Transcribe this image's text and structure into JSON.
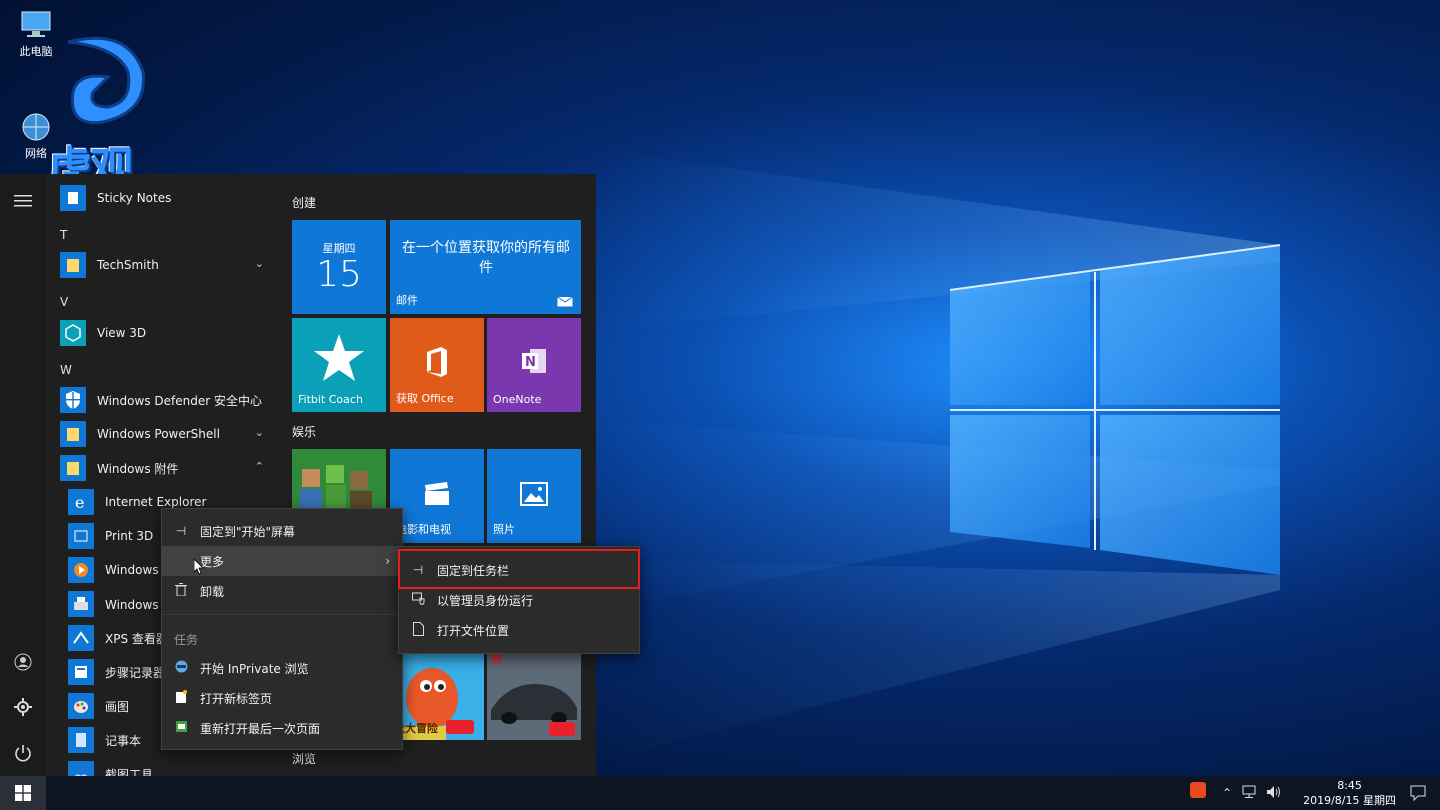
{
  "desktop": {
    "icons": [
      {
        "label": "此电脑"
      },
      {
        "label": "网络"
      }
    ],
    "watermark_text": "虎观"
  },
  "start_menu": {
    "rail": {
      "menu": "≡",
      "user": "user-icon",
      "settings": "gear-icon",
      "power": "power-icon"
    },
    "apps": [
      {
        "kind": "app",
        "label": "Sticky Notes"
      },
      {
        "kind": "letter",
        "label": "T"
      },
      {
        "kind": "app",
        "label": "TechSmith",
        "expandable": true
      },
      {
        "kind": "letter",
        "label": "V"
      },
      {
        "kind": "app",
        "label": "View 3D"
      },
      {
        "kind": "letter",
        "label": "W"
      },
      {
        "kind": "app",
        "label": "Windows Defender 安全中心"
      },
      {
        "kind": "app",
        "label": "Windows PowerShell",
        "expandable": true
      },
      {
        "kind": "app",
        "label": "Windows 附件",
        "expanded": true
      },
      {
        "kind": "sub",
        "label": "Internet Explorer"
      },
      {
        "kind": "sub",
        "label": "Print 3D"
      },
      {
        "kind": "sub",
        "label": "Windows M"
      },
      {
        "kind": "sub",
        "label": "Windows 传"
      },
      {
        "kind": "sub",
        "label": "XPS 查看器"
      },
      {
        "kind": "sub",
        "label": "步骤记录器"
      },
      {
        "kind": "sub",
        "label": "画图"
      },
      {
        "kind": "sub",
        "label": "记事本"
      },
      {
        "kind": "sub",
        "label": "截图工具"
      }
    ],
    "groups": {
      "create": "创建",
      "entertainment": "娱乐",
      "browse": "浏览"
    },
    "tiles": {
      "calendar_day": "星期四",
      "calendar_date": "15",
      "mail_text": "在一个位置获取你的所有邮件",
      "mail_label": "邮件",
      "fitbit": "Fitbit Coach",
      "office": "获取 Office",
      "onenote": "OneNote",
      "movies": "电影和电视",
      "photos": "照片",
      "game1_caption": "龙大冒险"
    }
  },
  "context_menu": {
    "pin_start": "固定到\"开始\"屏幕",
    "more": "更多",
    "uninstall": "卸载",
    "tasks_header": "任务",
    "inprivate": "开始 InPrivate 浏览",
    "new_tab": "打开新标签页",
    "reopen": "重新打开最后一次页面"
  },
  "submenu": {
    "pin_taskbar": "固定到任务栏",
    "run_admin": "以管理员身份运行",
    "open_location": "打开文件位置"
  },
  "taskbar": {
    "time": "8:45",
    "date": "2019/8/15 星期四"
  },
  "colors": {
    "tile_blue": "#0f78d7",
    "tile_teal": "#0aa0b8",
    "tile_orange": "#e05a19",
    "tile_purple": "#7a37ae",
    "tile_green": "#137d23",
    "highlight": "#e81c1c"
  }
}
